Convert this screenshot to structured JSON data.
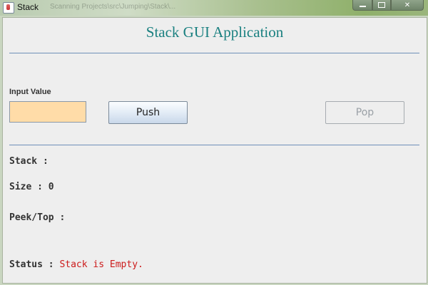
{
  "window": {
    "title": "Stack",
    "background_caption": "Scanning Projects\\src\\Jumping\\Stack\\...",
    "min_label": "",
    "close_label": "✕"
  },
  "app": {
    "heading": "Stack GUI Application",
    "heading_color": "#1a8080"
  },
  "input": {
    "label": "Input Value",
    "value": "",
    "placeholder": "",
    "background_color": "#ffdca8"
  },
  "buttons": {
    "push_label": "Push",
    "pop_label": "Pop",
    "pop_enabled": false
  },
  "info": {
    "stack_label": "Stack : ",
    "stack_value": "",
    "size_label": "Size : ",
    "size_value": "0",
    "peek_label": "Peek/Top : ",
    "peek_value": "",
    "status_label": "Status : ",
    "status_value": "Stack is Empty.",
    "status_color": "#cc1a1a"
  }
}
